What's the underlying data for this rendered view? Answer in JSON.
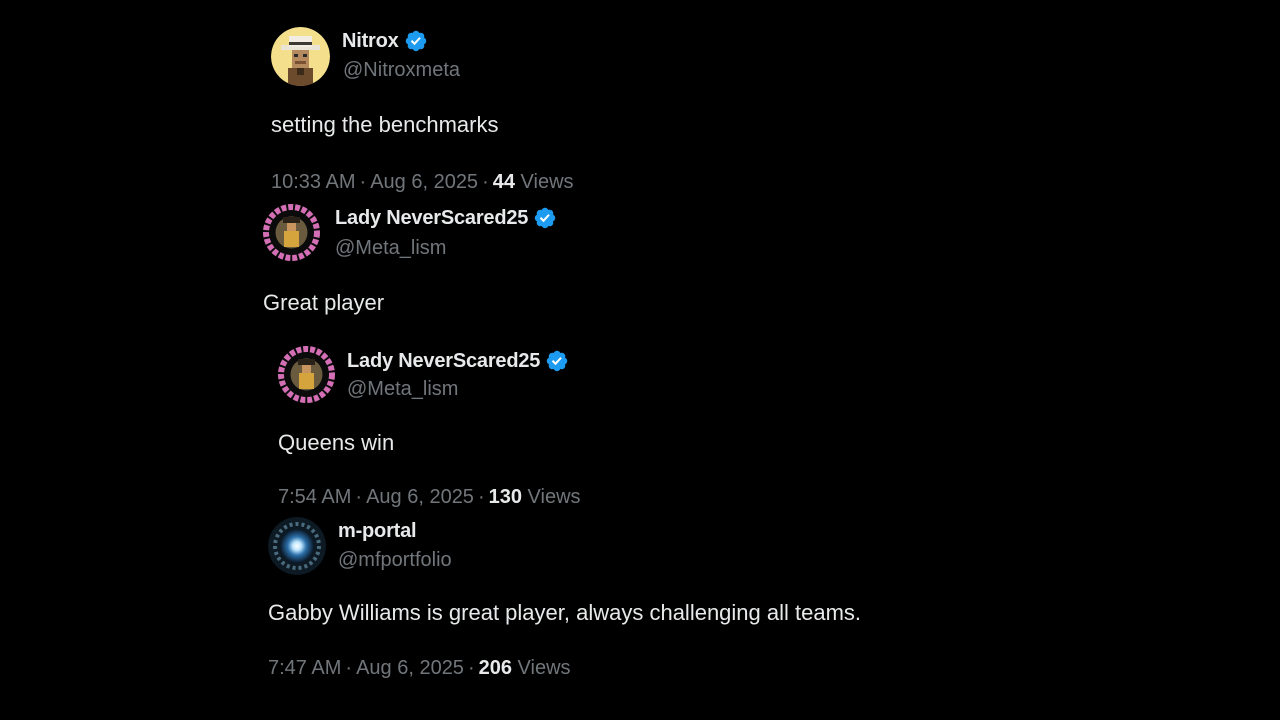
{
  "colors": {
    "background": "#000000",
    "text_primary": "#e7e9ea",
    "text_secondary": "#71767b",
    "verified_blue": "#1d9bf0"
  },
  "tweets": [
    {
      "name": "Nitrox",
      "verified": true,
      "handle": "@Nitroxmeta",
      "text": "setting the benchmarks",
      "time": "10:33 AM",
      "date": "Aug 6, 2025",
      "views_count": "44",
      "views_label": "Views",
      "avatar_icon": "cowboy-pixel-avatar"
    },
    {
      "name": "Lady NeverScared25",
      "verified": true,
      "handle": "@Meta_lism",
      "text": "Great player",
      "avatar_icon": "quakey-nation-community-badge"
    },
    {
      "name": "Lady NeverScared25",
      "verified": true,
      "handle": "@Meta_lism",
      "text": "Queens win",
      "time": "7:54 AM",
      "date": "Aug 6, 2025",
      "views_count": "130",
      "views_label": "Views",
      "avatar_icon": "quakey-nation-community-badge"
    },
    {
      "name": "m-portal",
      "verified": false,
      "handle": "@mfportfolio",
      "text": "Gabby Williams is great player, always challenging all teams.",
      "time": "7:47 AM",
      "date": "Aug 6, 2025",
      "views_count": "206",
      "views_label": "Views",
      "avatar_icon": "glowing-portal-avatar"
    }
  ]
}
